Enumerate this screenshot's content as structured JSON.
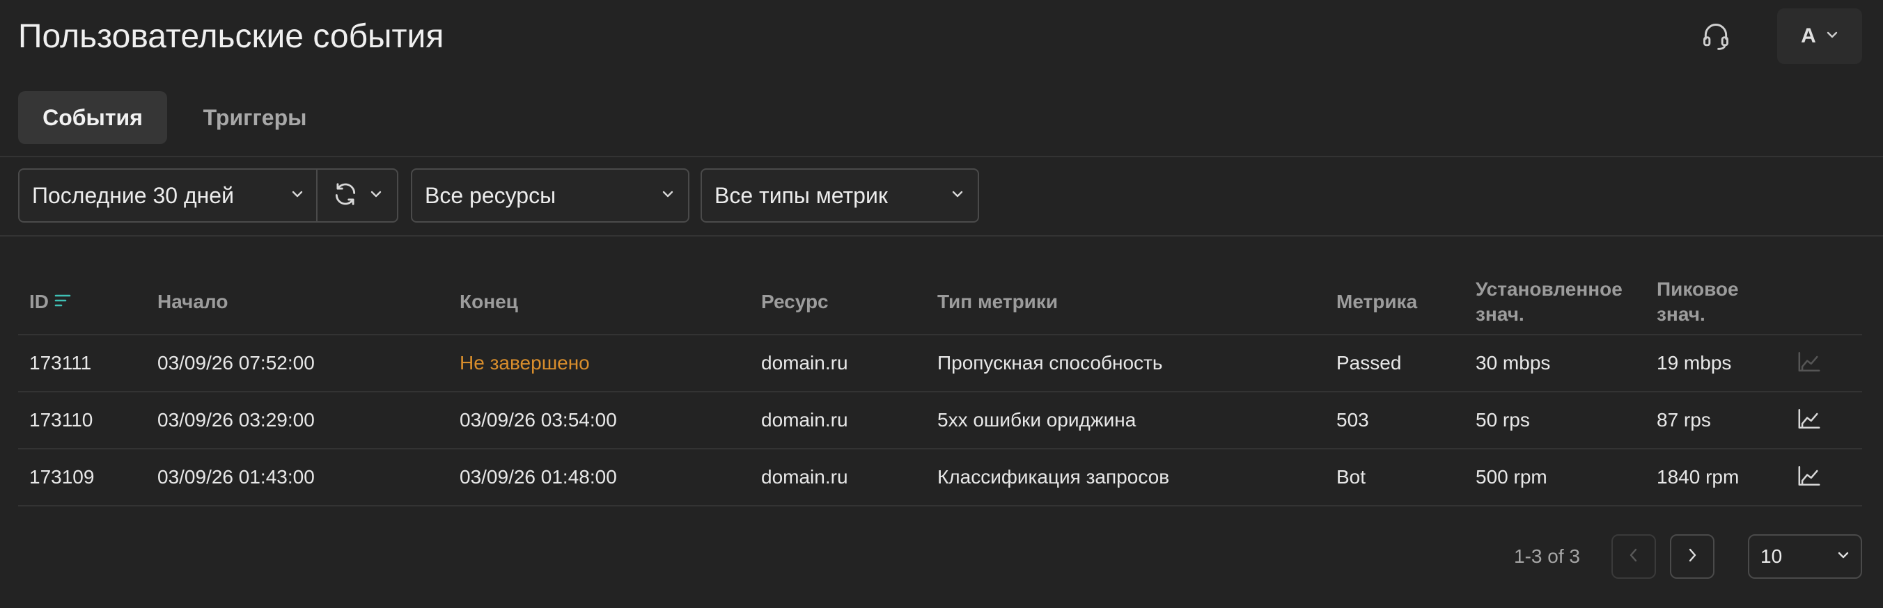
{
  "header": {
    "title": "Пользовательские события",
    "user_initial": "A"
  },
  "tabs": [
    {
      "label": "События",
      "active": true
    },
    {
      "label": "Триггеры",
      "active": false
    }
  ],
  "filters": {
    "period": "Последние 30 дней",
    "resources": "Все ресурсы",
    "metric_types": "Все типы метрик"
  },
  "table": {
    "columns": {
      "id": "ID",
      "start": "Начало",
      "end": "Конец",
      "resource": "Ресурс",
      "metric_type": "Тип метрики",
      "metric": "Метрика",
      "set_value_line1": "Установленное",
      "set_value_line2": "знач.",
      "peak_value_line1": "Пиковое",
      "peak_value_line2": "знач."
    },
    "rows": [
      {
        "id": "173111",
        "start": "03/09/26 07:52:00",
        "end": "Не завершено",
        "resource": "domain.ru",
        "metric_type": "Пропускная способность",
        "metric": "Passed",
        "set_value": "30 mbps",
        "peak_value": "19 mbps",
        "chart_enabled": false
      },
      {
        "id": "173110",
        "start": "03/09/26 03:29:00",
        "end": "03/09/26 03:54:00",
        "resource": "domain.ru",
        "metric_type": "5xx ошибки ориджина",
        "metric": "503",
        "set_value": "50 rps",
        "peak_value": "87 rps",
        "chart_enabled": true
      },
      {
        "id": "173109",
        "start": "03/09/26 01:43:00",
        "end": "03/09/26 01:48:00",
        "resource": "domain.ru",
        "metric_type": "Классификация запросов",
        "metric": "Bot",
        "set_value": "500 rpm",
        "peak_value": "1840 rpm",
        "chart_enabled": true
      }
    ]
  },
  "pagination": {
    "range": "1-3 of 3",
    "page_size": "10"
  },
  "colors": {
    "background": "#232323",
    "accent_sort": "#3fc1b5",
    "warning": "#d98e2c"
  }
}
